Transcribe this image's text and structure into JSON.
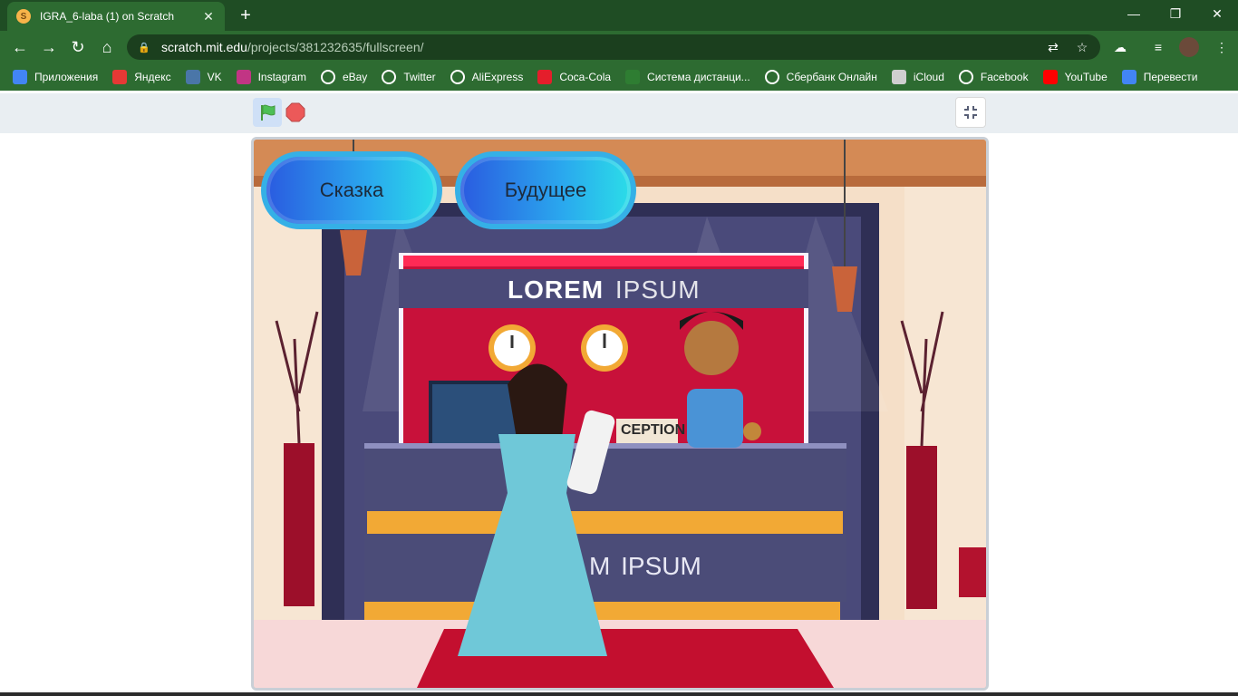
{
  "browser": {
    "tab_title": "IGRA_6-laba (1) on Scratch",
    "url_host": "scratch.mit.edu",
    "url_path": "/projects/381232635/fullscreen/",
    "bookmarks": [
      {
        "label": "Приложения",
        "icon": "apps-grid-icon",
        "color": "#4285f4"
      },
      {
        "label": "Яндекс",
        "icon": "yandex-icon",
        "color": "#e53935"
      },
      {
        "label": "VK",
        "icon": "vk-icon",
        "color": "#4a76a8"
      },
      {
        "label": "Instagram",
        "icon": "instagram-icon",
        "color": "#c13584"
      },
      {
        "label": "eBay",
        "icon": "globe-icon",
        "color": "#ffffff"
      },
      {
        "label": "Twitter",
        "icon": "globe-icon",
        "color": "#ffffff"
      },
      {
        "label": "AliExpress",
        "icon": "globe-icon",
        "color": "#ffffff"
      },
      {
        "label": "Coca-Cola",
        "icon": "coca-cola-icon",
        "color": "#e41e2b"
      },
      {
        "label": "Система дистанци...",
        "icon": "leaf-icon",
        "color": "#2e7d32"
      },
      {
        "label": "Сбербанк Онлайн",
        "icon": "globe-icon",
        "color": "#ffffff"
      },
      {
        "label": "iCloud",
        "icon": "apple-icon",
        "color": "#cfcfcf"
      },
      {
        "label": "Facebook",
        "icon": "globe-icon",
        "color": "#ffffff"
      },
      {
        "label": "YouTube",
        "icon": "youtube-icon",
        "color": "#ff0000"
      },
      {
        "label": "Перевести",
        "icon": "translate-icon",
        "color": "#4285f4"
      }
    ]
  },
  "stage": {
    "buttons": [
      {
        "label": "Сказка"
      },
      {
        "label": "Будущее"
      }
    ],
    "sign_text_bold": "LOREM",
    "sign_text_light": "IPSUM",
    "desk_text_light": "IPSUM",
    "desk_text_partial": "M",
    "reception_text": "CEPTION"
  },
  "colors": {
    "chrome_dark": "#1f4d24",
    "chrome": "#2d6b31",
    "accent_blue": "#2aa8ee"
  }
}
